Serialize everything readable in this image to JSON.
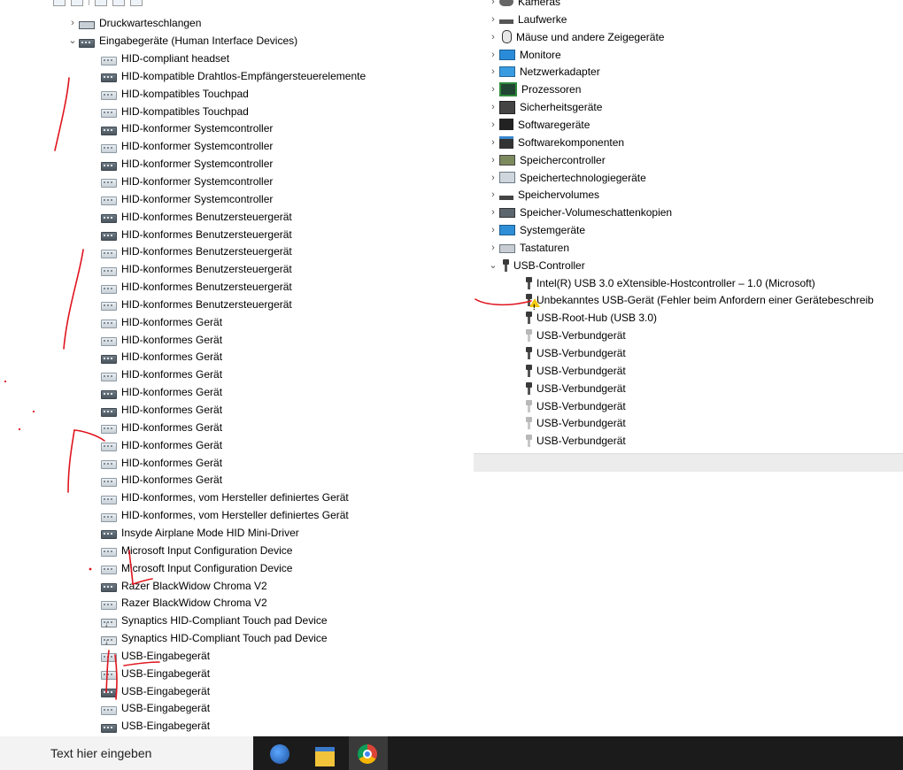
{
  "left_tree": {
    "categories": [
      {
        "label": "Druckwarteschlangen",
        "expanded": false,
        "icon": "printer-icon"
      },
      {
        "label": "Eingabegeräte (Human Interface Devices)",
        "expanded": true,
        "icon": "hid-category-icon"
      }
    ],
    "items": [
      {
        "label": "HID-compliant headset",
        "icon": "hid-icon",
        "style": "light"
      },
      {
        "label": "HID-kompatible Drahtlos-Empfängersteuerelemente",
        "icon": "hid-icon",
        "style": "dark"
      },
      {
        "label": "HID-kompatibles Touchpad",
        "icon": "hid-icon",
        "style": "light"
      },
      {
        "label": "HID-kompatibles Touchpad",
        "icon": "hid-icon",
        "style": "light"
      },
      {
        "label": "HID-konformer Systemcontroller",
        "icon": "hid-icon",
        "style": "dark"
      },
      {
        "label": "HID-konformer Systemcontroller",
        "icon": "hid-icon",
        "style": "light"
      },
      {
        "label": "HID-konformer Systemcontroller",
        "icon": "hid-icon",
        "style": "dark"
      },
      {
        "label": "HID-konformer Systemcontroller",
        "icon": "hid-icon",
        "style": "light"
      },
      {
        "label": "HID-konformer Systemcontroller",
        "icon": "hid-icon",
        "style": "light"
      },
      {
        "label": "HID-konformes Benutzersteuergerät",
        "icon": "hid-icon",
        "style": "dark"
      },
      {
        "label": "HID-konformes Benutzersteuergerät",
        "icon": "hid-icon",
        "style": "dark"
      },
      {
        "label": "HID-konformes Benutzersteuergerät",
        "icon": "hid-icon",
        "style": "light"
      },
      {
        "label": "HID-konformes Benutzersteuergerät",
        "icon": "hid-icon",
        "style": "light"
      },
      {
        "label": "HID-konformes Benutzersteuergerät",
        "icon": "hid-icon",
        "style": "light"
      },
      {
        "label": "HID-konformes Benutzersteuergerät",
        "icon": "hid-icon",
        "style": "light"
      },
      {
        "label": "HID-konformes Gerät",
        "icon": "hid-icon",
        "style": "light"
      },
      {
        "label": "HID-konformes Gerät",
        "icon": "hid-icon",
        "style": "light"
      },
      {
        "label": "HID-konformes Gerät",
        "icon": "hid-icon",
        "style": "dark"
      },
      {
        "label": "HID-konformes Gerät",
        "icon": "hid-icon",
        "style": "light"
      },
      {
        "label": "HID-konformes Gerät",
        "icon": "hid-icon",
        "style": "dark"
      },
      {
        "label": "HID-konformes Gerät",
        "icon": "hid-icon",
        "style": "dark"
      },
      {
        "label": "HID-konformes Gerät",
        "icon": "hid-icon",
        "style": "light"
      },
      {
        "label": "HID-konformes Gerät",
        "icon": "hid-icon",
        "style": "light"
      },
      {
        "label": "HID-konformes Gerät",
        "icon": "hid-icon",
        "style": "light"
      },
      {
        "label": "HID-konformes Gerät",
        "icon": "hid-icon",
        "style": "light"
      },
      {
        "label": "HID-konformes, vom Hersteller definiertes Gerät",
        "icon": "hid-icon",
        "style": "light"
      },
      {
        "label": "HID-konformes, vom Hersteller definiertes Gerät",
        "icon": "hid-icon",
        "style": "light"
      },
      {
        "label": "Insyde Airplane Mode HID Mini-Driver",
        "icon": "hid-icon",
        "style": "dark"
      },
      {
        "label": "Microsoft Input Configuration Device",
        "icon": "hid-icon",
        "style": "light"
      },
      {
        "label": "Microsoft Input Configuration Device",
        "icon": "hid-icon",
        "style": "light"
      },
      {
        "label": "Razer BlackWidow Chroma V2",
        "icon": "hid-icon",
        "style": "dark"
      },
      {
        "label": "Razer BlackWidow Chroma V2",
        "icon": "hid-icon",
        "style": "light"
      },
      {
        "label": "Synaptics HID-Compliant Touch pad Device",
        "icon": "hid-download-icon",
        "style": "dl"
      },
      {
        "label": "Synaptics HID-Compliant Touch pad Device",
        "icon": "hid-download-icon",
        "style": "dl"
      },
      {
        "label": "USB-Eingabegerät",
        "icon": "hid-icon",
        "style": "light"
      },
      {
        "label": "USB-Eingabegerät",
        "icon": "hid-icon",
        "style": "light"
      },
      {
        "label": "USB-Eingabegerät",
        "icon": "hid-icon",
        "style": "dark"
      },
      {
        "label": "USB-Eingabegerät",
        "icon": "hid-icon",
        "style": "light"
      },
      {
        "label": "USB-Eingabegerät",
        "icon": "hid-icon",
        "style": "dark"
      }
    ]
  },
  "right_tree": {
    "categories": [
      {
        "label": "Kameras",
        "icon": "camera-icon",
        "cls": "cam"
      },
      {
        "label": "Laufwerke",
        "icon": "disk-drive-icon",
        "cls": "drive"
      },
      {
        "label": "Mäuse und andere Zeigegeräte",
        "icon": "mouse-icon",
        "cls": "mouse"
      },
      {
        "label": "Monitore",
        "icon": "monitor-icon",
        "cls": "monitor"
      },
      {
        "label": "Netzwerkadapter",
        "icon": "network-adapter-icon",
        "cls": "net"
      },
      {
        "label": "Prozessoren",
        "icon": "processor-icon",
        "cls": "cpu"
      },
      {
        "label": "Sicherheitsgeräte",
        "icon": "security-device-icon",
        "cls": "sec"
      },
      {
        "label": "Softwaregeräte",
        "icon": "software-device-icon",
        "cls": "sw"
      },
      {
        "label": "Softwarekomponenten",
        "icon": "software-component-icon",
        "cls": "swc"
      },
      {
        "label": "Speichercontroller",
        "icon": "storage-controller-icon",
        "cls": "storc"
      },
      {
        "label": "Speichertechnologiegeräte",
        "icon": "storage-technology-icon",
        "cls": "stortech"
      },
      {
        "label": "Speichervolumes",
        "icon": "storage-volume-icon",
        "cls": "vol"
      },
      {
        "label": "Speicher-Volumeschattenkopien",
        "icon": "shadow-copy-icon",
        "cls": "vss"
      },
      {
        "label": "Systemgeräte",
        "icon": "system-device-icon",
        "cls": "sys"
      },
      {
        "label": "Tastaturen",
        "icon": "keyboard-icon",
        "cls": "kbd"
      },
      {
        "label": "USB-Controller",
        "icon": "usb-icon",
        "cls": "usb",
        "expanded": true
      }
    ],
    "usb_items": [
      {
        "label": "Intel(R) USB 3.0 eXtensible-Hostcontroller – 1.0 (Microsoft)",
        "icon": "usb-icon",
        "style": "dark"
      },
      {
        "label": "Unbekanntes USB-Gerät (Fehler beim Anfordern einer Gerätebeschreib",
        "icon": "usb-warning-icon",
        "style": "warn"
      },
      {
        "label": "USB-Root-Hub (USB 3.0)",
        "icon": "usb-icon",
        "style": "dark"
      },
      {
        "label": "USB-Verbundgerät",
        "icon": "usb-icon",
        "style": "light"
      },
      {
        "label": "USB-Verbundgerät",
        "icon": "usb-icon",
        "style": "dark"
      },
      {
        "label": "USB-Verbundgerät",
        "icon": "usb-icon",
        "style": "dark"
      },
      {
        "label": "USB-Verbundgerät",
        "icon": "usb-icon",
        "style": "dark"
      },
      {
        "label": "USB-Verbundgerät",
        "icon": "usb-icon",
        "style": "light"
      },
      {
        "label": "USB-Verbundgerät",
        "icon": "usb-icon",
        "style": "light"
      },
      {
        "label": "USB-Verbundgerät",
        "icon": "usb-icon",
        "style": "light"
      }
    ]
  },
  "taskbar": {
    "search_placeholder": "Text hier eingeben",
    "apps": [
      "app-icon",
      "file-explorer-icon",
      "chrome-icon"
    ]
  },
  "colors": {
    "annotation_red": "#e0141e",
    "taskbar_bg": "#1b1b1b",
    "warning_yellow": "#f2c811"
  }
}
